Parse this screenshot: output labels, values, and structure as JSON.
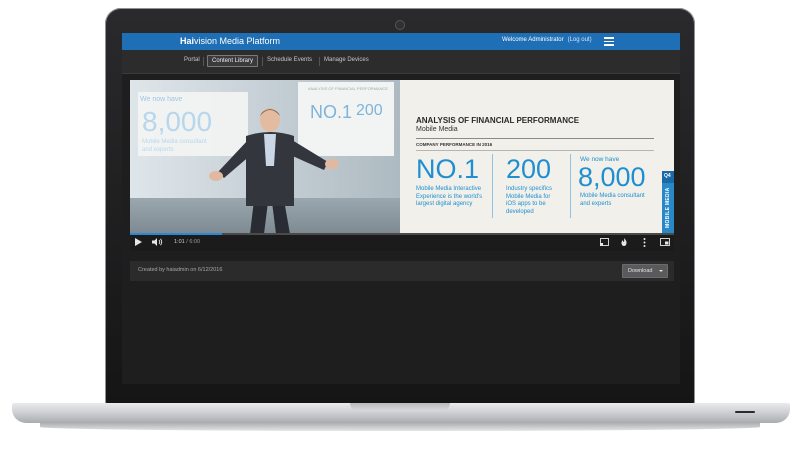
{
  "app": {
    "brand_prefix": "Hai",
    "brand_rest": "vision Media Platform",
    "welcome": "Welcome Administrator",
    "logout": "(Log out)",
    "menu_icon": "hamburger-menu-icon",
    "accent": "#1f6fb6"
  },
  "nav": {
    "items": [
      {
        "label": "Portal",
        "active": false
      },
      {
        "label": "Content Library",
        "active": true
      },
      {
        "label": "Schedule Events",
        "active": false
      },
      {
        "label": "Manage Devices",
        "active": false
      }
    ]
  },
  "video_frame": {
    "wall_screen_left": {
      "line1": "We now have",
      "number": "8,000",
      "line2": "Mobile Media consultant",
      "line3": "and experts"
    },
    "wall_screen_right": {
      "heading": "ANALYSIS OF FINANCIAL PERFORMANCE",
      "stat1": "NO.1",
      "stat2": "200"
    },
    "slide": {
      "title": "ANALYSIS OF FINANCIAL PERFORMANCE",
      "subtitle": "Mobile Media",
      "section": "COMPANY PERFORMANCE IN 2016",
      "stats": [
        {
          "value": "NO.1",
          "text_lines": [
            "Mobile Media Interactive",
            "Experience is the world's",
            "largest digital agency"
          ]
        },
        {
          "value": "200",
          "text_lines": [
            "Industry specifics",
            "Mobile Media for",
            "iOS apps to be",
            "developed"
          ]
        },
        {
          "prefix": "We now have",
          "value": "8,000",
          "text_lines": [
            "Mobile Media consultant",
            "and experts"
          ]
        }
      ],
      "side_tab_quarter": "Q4",
      "side_tab_label": "MOBILE MEDIA",
      "accent": "#1f8fd1"
    }
  },
  "player": {
    "current_time": "1:01",
    "separator": " / ",
    "duration": "6:00",
    "progress_fraction": 0.17,
    "icons": [
      "play-icon",
      "volume-icon",
      "cast-icon",
      "fire-icon",
      "more-options-icon",
      "fullscreen-icon"
    ]
  },
  "meta": {
    "created_text": "Created by haiadmin on 6/12/2016",
    "download_label": "Download"
  }
}
